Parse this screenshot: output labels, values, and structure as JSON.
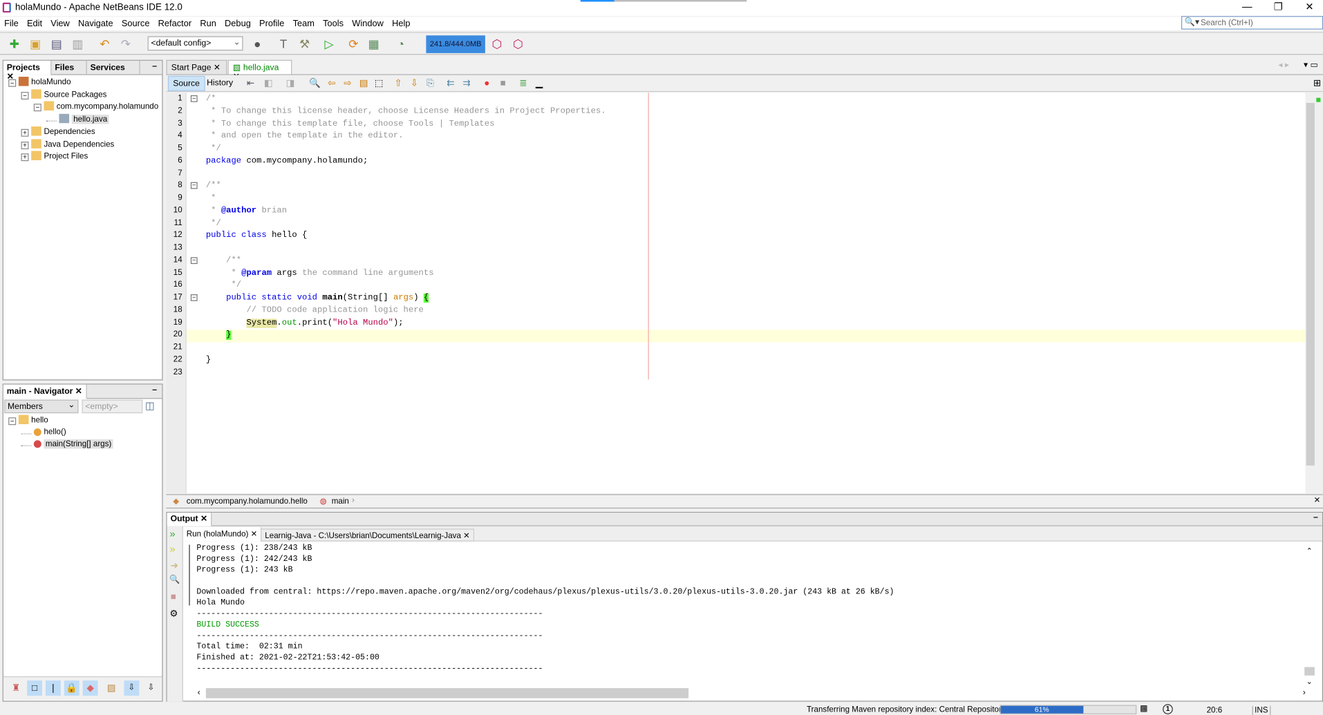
{
  "window": {
    "title": "holaMundo - Apache NetBeans IDE 12.0",
    "minimize": "—",
    "restore": "❐",
    "close": "✕"
  },
  "menu": [
    "File",
    "Edit",
    "View",
    "Navigate",
    "Source",
    "Refactor",
    "Run",
    "Debug",
    "Profile",
    "Team",
    "Tools",
    "Window",
    "Help"
  ],
  "search": {
    "placeholder": "Search (Ctrl+I)",
    "icon": "search-icon"
  },
  "toolbar": {
    "config": "<default config>",
    "memory": "241.8/444.0MB"
  },
  "projects": {
    "tabs": [
      "Projects",
      "Files",
      "Services"
    ],
    "tree": [
      {
        "label": "holaMundo",
        "icon": "maven-project-icon",
        "level": 0,
        "expander": "−"
      },
      {
        "label": "Source Packages",
        "icon": "source-packages-icon",
        "level": 1,
        "expander": "−"
      },
      {
        "label": "com.mycompany.holamundo",
        "icon": "package-icon",
        "level": 2,
        "expander": "−"
      },
      {
        "label": "hello.java",
        "icon": "java-file-icon",
        "level": 3,
        "expander": "",
        "selected": true
      },
      {
        "label": "Dependencies",
        "icon": "dependencies-icon",
        "level": 1,
        "expander": "+"
      },
      {
        "label": "Java Dependencies",
        "icon": "dependencies-icon",
        "level": 1,
        "expander": "+"
      },
      {
        "label": "Project Files",
        "icon": "project-files-icon",
        "level": 1,
        "expander": "+"
      }
    ]
  },
  "navigator": {
    "title": "main - Navigator",
    "filter": "Members",
    "empty": "<empty>",
    "tree": [
      {
        "label": "hello",
        "icon": "class-icon",
        "level": 0,
        "expander": "−"
      },
      {
        "label": "hello()",
        "icon": "constructor-icon",
        "level": 1
      },
      {
        "label": "main(String[] args)",
        "icon": "method-icon",
        "level": 1,
        "selected": true
      }
    ]
  },
  "editor": {
    "tabs": [
      "Start Page",
      "hello.java"
    ],
    "active_tab": "hello.java",
    "views": [
      "Source",
      "History"
    ],
    "lines": [
      [
        [
          "cm",
          "/*"
        ]
      ],
      [
        [
          "cm",
          " * To change this license header, choose License Headers in Project Properties."
        ]
      ],
      [
        [
          "cm",
          " * To change this template file, choose Tools | Templates"
        ]
      ],
      [
        [
          "cm",
          " * and open the template in the editor."
        ]
      ],
      [
        [
          "cm",
          " */"
        ]
      ],
      [
        [
          "kw",
          "package"
        ],
        [
          "pl",
          " com.mycompany.holamundo;"
        ]
      ],
      [],
      [
        [
          "cm",
          "/**"
        ]
      ],
      [
        [
          "cm",
          " *"
        ]
      ],
      [
        [
          "cm",
          " * "
        ],
        [
          "tg",
          "@author"
        ],
        [
          "cm",
          " brian"
        ]
      ],
      [
        [
          "cm",
          " */"
        ]
      ],
      [
        [
          "kw",
          "public class"
        ],
        [
          "pl",
          " hello {"
        ]
      ],
      [],
      [
        [
          "cm",
          "    /**"
        ]
      ],
      [
        [
          "cm",
          "     * "
        ],
        [
          "tg",
          "@param"
        ],
        [
          "pl",
          " args"
        ],
        [
          "cm",
          " the command line arguments"
        ]
      ],
      [
        [
          "cm",
          "     */"
        ]
      ],
      [
        [
          "kw",
          "    public static void"
        ],
        [
          "pl",
          " "
        ],
        [
          "mth",
          "main"
        ],
        [
          "pl",
          "(String[] "
        ],
        [
          "st",
          "args"
        ],
        [
          "pl",
          ") "
        ],
        [
          "br",
          "{"
        ]
      ],
      [
        [
          "cm",
          "        // TODO code application logic here"
        ]
      ],
      [
        [
          "pl",
          "        "
        ],
        [
          "hl",
          "System"
        ],
        [
          "pl",
          "."
        ],
        [
          "fld",
          "out"
        ],
        [
          "pl",
          ".print("
        ],
        [
          "str",
          "\"Hola Mundo\""
        ],
        [
          "pl",
          ");"
        ]
      ],
      [
        [
          "pl",
          "    "
        ],
        [
          "br",
          "}"
        ]
      ],
      [],
      [
        [
          "pl",
          "}"
        ]
      ],
      []
    ],
    "breadcrumb": [
      "com.mycompany.holamundo.hello",
      "main"
    ]
  },
  "output": {
    "title": "Output",
    "tabs": [
      "Run (holaMundo)",
      "Learnig-Java - C:\\Users\\brian\\Documents\\Learnig-Java"
    ],
    "lines": [
      "Progress (1): 238/243 kB",
      "Progress (1): 242/243 kB",
      "Progress (1): 243 kB",
      "",
      "Downloaded from central: https://repo.maven.apache.org/maven2/org/codehaus/plexus/plexus-utils/3.0.20/plexus-utils-3.0.20.jar (243 kB at 26 kB/s)",
      "Hola Mundo",
      "------------------------------------------------------------------------",
      "BUILD SUCCESS",
      "------------------------------------------------------------------------",
      "Total time:  02:31 min",
      "Finished at: 2021-02-22T21:53:42-05:00",
      "------------------------------------------------------------------------"
    ],
    "success_line": "BUILD SUCCESS",
    "success_color": "#009900"
  },
  "status": {
    "task": "Transferring Maven repository index: Central Repository",
    "progress_percent": 61,
    "progress_label": "61%",
    "notifications": "1",
    "position": "20:6",
    "mode": "INS"
  }
}
